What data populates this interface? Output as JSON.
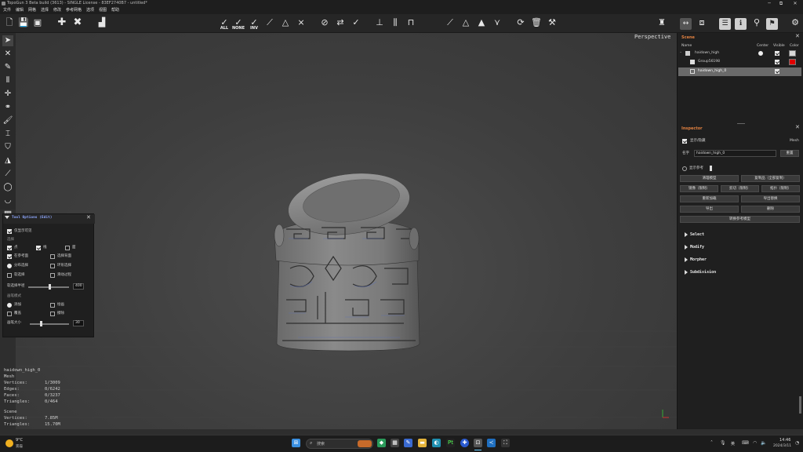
{
  "window": {
    "title": "TopoGun 3 Beta build (3613) - SINGLE License - 83EF2740B7 - untitled*",
    "minimize": "─",
    "maximize": "⧉",
    "close": "✕"
  },
  "menu": [
    "文件",
    "编辑",
    "网格",
    "选择",
    "修改",
    "参考网格",
    "选项",
    "视图",
    "帮助"
  ],
  "toolbar": {
    "select_all": "ALL",
    "select_none": "NONE",
    "select_inv": "INV"
  },
  "viewport": {
    "perspective_label": "Perspective"
  },
  "tool_options": {
    "title": "Tool Options (Edit)",
    "close": "✕",
    "only_visible": "仅显示可见",
    "selection": "选择",
    "pts": "点",
    "edges": "线",
    "faces": "面",
    "select_on_ref": "在参考面",
    "select_backfaces": "选择背面",
    "select_by_connected": "分布选择",
    "loop_select": "环形选择",
    "soft_select": "软选择",
    "slide": "滑动过程",
    "falloff_label": "软选择半径",
    "falloff_value": "400",
    "brush_mode": "画笔模式",
    "mode_add": "添加",
    "mode_paint": "绘画",
    "mode_replace": "覆盖",
    "mode_erase": "擦除",
    "brush_size_label": "画笔大小",
    "brush_size_value": "30"
  },
  "stats": {
    "mesh_name": "haidown_high_0",
    "mesh_type": "Mesh",
    "vertices_label": "Vertices:",
    "vertices_value": "1/3009",
    "edges_label": "Edges:",
    "edges_value": "0/6242",
    "faces_label": "Faces:",
    "faces_value": "0/3237",
    "triangles_label": "Triangles:",
    "triangles_value": "0/464",
    "scene_label": "Scene",
    "scene_vertices_label": "Vertices:",
    "scene_vertices_value": "7.85M",
    "scene_triangles_label": "Triangles:",
    "scene_triangles_value": "15.70M"
  },
  "scene_panel": {
    "title": "Scene",
    "close": "✕",
    "col_name": "Name",
    "col_center": "Center",
    "col_visible": "Visible",
    "col_color": "Color",
    "items": [
      {
        "name": "haidown_high",
        "color": "#d8d8d8"
      },
      {
        "name": "Group56198",
        "color": "#e00000"
      },
      {
        "name": "haidown_high_0",
        "color": ""
      }
    ]
  },
  "inspector": {
    "title": "Inspector",
    "close": "✕",
    "show_hide": "显示/隐藏",
    "mesh_type": "Mesh",
    "name_label": "名字",
    "name_value": "haidown_high_0",
    "rename": "重置",
    "show_ref": "显示参考",
    "buttons": [
      "清理模型",
      "复制品（全部复制）",
      "镜像（限制）",
      "剪切（限制）",
      "拓扑（限制）",
      "重新加载",
      "导出替换",
      "导出",
      "删除",
      "转换参考模型"
    ],
    "sections": [
      "Select",
      "Modify",
      "Morpher",
      "Subdivision"
    ]
  },
  "taskbar": {
    "weather_temp": "9°C",
    "weather_desc": "雾霾",
    "search_placeholder": "搜索",
    "ime": "英",
    "time": "14:46",
    "date": "2024/3/11"
  },
  "colors": {
    "accent_orange": "#e08040",
    "tool_header_blue": "#8fa8ff",
    "viewport_bg": "#3e3e3e"
  }
}
